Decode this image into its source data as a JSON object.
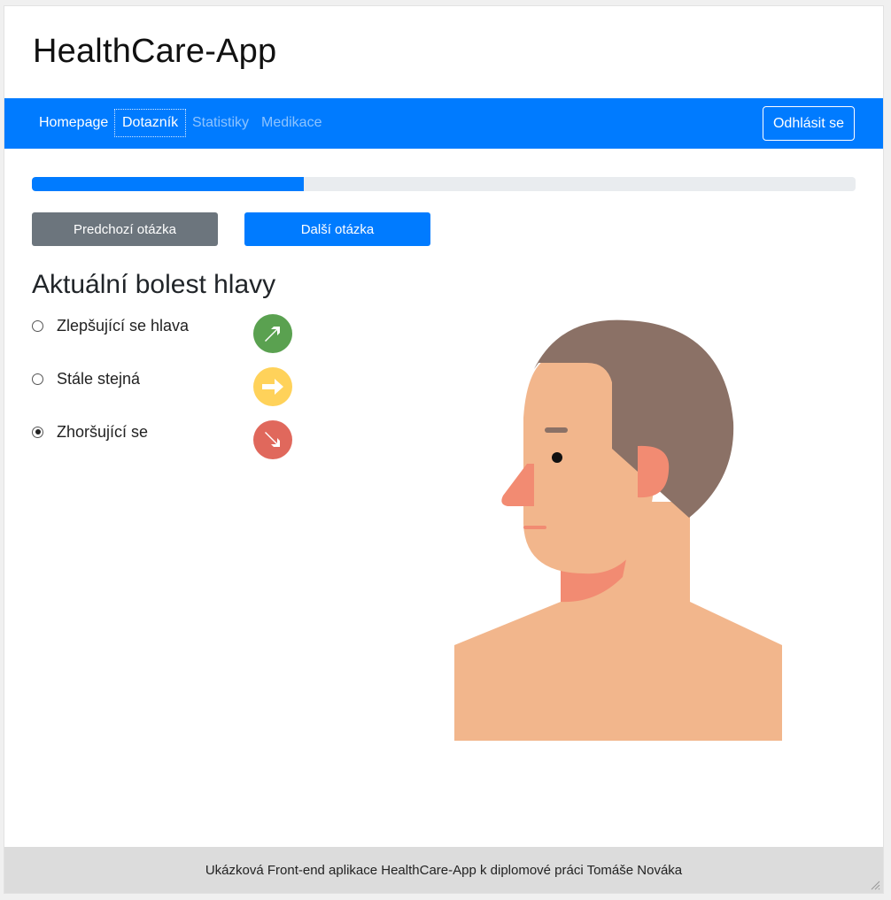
{
  "app": {
    "title": "HealthCare-App"
  },
  "nav": {
    "items": [
      {
        "label": "Homepage"
      },
      {
        "label": "Dotazník"
      },
      {
        "label": "Statistiky"
      },
      {
        "label": "Medikace"
      }
    ],
    "logout_label": "Odhlásit se"
  },
  "progress": {
    "value": 0.33
  },
  "buttons": {
    "prev_label": "Predchozí otázka",
    "next_label": "Další otázka"
  },
  "question": {
    "title": "Aktuální bolest hlavy",
    "selected_index": 2,
    "options": [
      {
        "label": "Zlepšující se hlava",
        "icon": "arrow-up-right-icon",
        "color": "#5aa150"
      },
      {
        "label": "Stále stejná",
        "icon": "arrow-right-icon",
        "color": "#ffd25a"
      },
      {
        "label": "Zhoršující se",
        "icon": "arrow-down-right-icon",
        "color": "#e0685c"
      }
    ]
  },
  "illustration": {
    "icon": "head-profile-illustration"
  },
  "colors": {
    "primary": "#007bff",
    "secondary": "#6c757d",
    "hair": "#8b7166",
    "skin": "#f2b68c",
    "accent_skin": "#f28b72"
  },
  "footer": {
    "text": "Ukázková Front-end aplikace HealthCare-App k diplomové práci Tomáše Nováka"
  }
}
